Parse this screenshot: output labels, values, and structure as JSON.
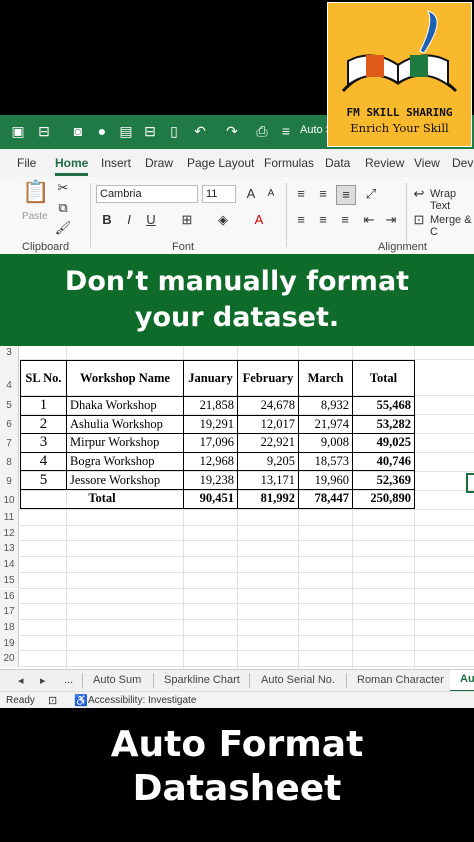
{
  "logo": {
    "line1": "FM SKILL SHARING",
    "line2": "Enrich Your Skill"
  },
  "titlebar": {
    "doc_label": "Auto S"
  },
  "ribbon_tabs": [
    "File",
    "Home",
    "Insert",
    "Draw",
    "Page Layout",
    "Formulas",
    "Data",
    "Review",
    "View",
    "Deve"
  ],
  "ribbon": {
    "paste_label": "Paste",
    "font_name": "Cambria",
    "font_size": "11",
    "clipboard_label": "Clipboard",
    "font_label": "Font",
    "alignment_label": "Alignment",
    "wrap_text": "Wrap Text",
    "merge_label": "Merge & C"
  },
  "banner": {
    "line1": "Don’t manually format",
    "line2": "your dataset."
  },
  "sheet": {
    "row_numbers": [
      "3",
      "4",
      "5",
      "6",
      "7",
      "8",
      "9",
      "10",
      "11",
      "12",
      "13",
      "14",
      "15",
      "16",
      "17",
      "18",
      "19",
      "20"
    ],
    "headers": [
      "SL No.",
      "Workshop Name",
      "January",
      "February",
      "March",
      "Total"
    ],
    "rows": [
      [
        "1",
        "Dhaka Workshop",
        "21,858",
        "24,678",
        "8,932",
        "55,468"
      ],
      [
        "2",
        "Ashulia Workshop",
        "19,291",
        "12,017",
        "21,974",
        "53,282"
      ],
      [
        "3",
        "Mirpur Workshop",
        "17,096",
        "22,921",
        "9,008",
        "49,025"
      ],
      [
        "4",
        "Bogra Workshop",
        "12,968",
        "9,205",
        "18,573",
        "40,746"
      ],
      [
        "5",
        "Jessore Workshop",
        "19,238",
        "13,171",
        "19,960",
        "52,369"
      ]
    ],
    "total_row": [
      "Total",
      "90,451",
      "81,992",
      "78,447",
      "250,890"
    ]
  },
  "sheet_tabs": {
    "ellipsis": "...",
    "tabs": [
      "Auto Sum",
      "Sparkline Chart",
      "Auto Serial No.",
      "Roman Character",
      "Au"
    ]
  },
  "status": {
    "ready": "Ready",
    "accessibility": "Accessibility: Investigate"
  },
  "bottom": {
    "line1": "Auto Format",
    "line2": "Datasheet"
  },
  "colors": {
    "excel_green": "#1f7a45",
    "banner_green": "#0f6b2a",
    "logo_yellow": "#f9b92d"
  }
}
